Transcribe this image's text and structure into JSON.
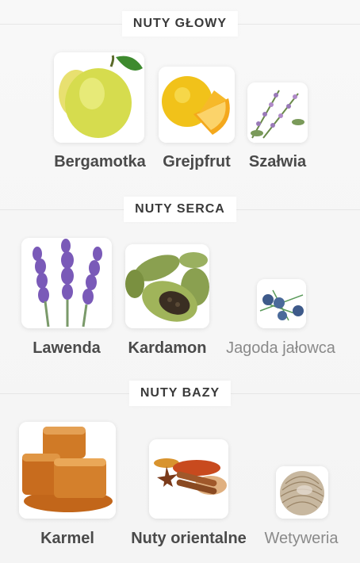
{
  "sections": [
    {
      "title": "NUTY GŁOWY",
      "notes": [
        {
          "label": "Bergamotka",
          "icon": "bergamot-icon"
        },
        {
          "label": "Grejpfrut",
          "icon": "grapefruit-icon"
        },
        {
          "label": "Szałwia",
          "icon": "sage-icon"
        }
      ]
    },
    {
      "title": "NUTY SERCA",
      "notes": [
        {
          "label": "Lawenda",
          "icon": "lavender-icon"
        },
        {
          "label": "Kardamon",
          "icon": "cardamom-icon"
        },
        {
          "label": "Jagoda jałowca",
          "icon": "juniper-berry-icon"
        }
      ]
    },
    {
      "title": "NUTY BAZY",
      "notes": [
        {
          "label": "Karmel",
          "icon": "caramel-icon"
        },
        {
          "label": "Nuty orientalne",
          "icon": "oriental-spices-icon"
        },
        {
          "label": "Wetyweria",
          "icon": "vetiver-icon"
        }
      ]
    }
  ]
}
